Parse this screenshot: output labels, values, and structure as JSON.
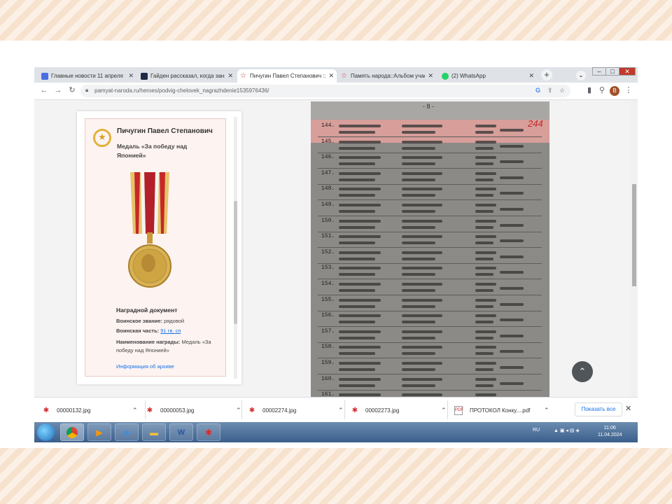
{
  "browser": {
    "tabs": [
      {
        "title": "Главные новости 11 апреля",
        "icon": "news-icon",
        "color": "#4a6fe3"
      },
      {
        "title": "Гайден рассказал, когда заня",
        "icon": "dzen-icon",
        "color": "#1f2a44"
      },
      {
        "title": "Пичугин Павел Степанович ::",
        "icon": "star-icon",
        "color": "#d32f2f"
      },
      {
        "title": "Память народа::Альбом учас",
        "icon": "star-icon",
        "color": "#d32f2f"
      },
      {
        "title": "(2) WhatsApp",
        "icon": "whatsapp-icon",
        "color": "#25d366"
      }
    ],
    "url": "pamyat-naroda.ru/heroes/podvig-chelovek_nagrazhdenie1535976436/",
    "avatar_letter": "В"
  },
  "card": {
    "name": "Пичугин Павел Степанович",
    "medal": "Медаль «За победу над Японией»",
    "section": "Наградной документ",
    "rank_label": "Воинское звание:",
    "rank_value": "рядовой",
    "unit_label": "Воинская часть:",
    "unit_value": "91 гв. сп",
    "award_label": "Наименование награды:",
    "award_value": "Медаль «За победу над Японией»",
    "archive_link": "Информация об архиве"
  },
  "document": {
    "page_number": "- 8 -",
    "annotation": "244",
    "row_numbers": [
      "144.",
      "145.",
      "146.",
      "147.",
      "148.",
      "149.",
      "150.",
      "151.",
      "152.",
      "153.",
      "154.",
      "155.",
      "156.",
      "157.",
      "158.",
      "159.",
      "160.",
      "161."
    ]
  },
  "downloads": {
    "items": [
      {
        "name": "00000132.jpg",
        "type": "image"
      },
      {
        "name": "00000053.jpg",
        "type": "image"
      },
      {
        "name": "00002274.jpg",
        "type": "image"
      },
      {
        "name": "00002273.jpg",
        "type": "image"
      },
      {
        "name": "ПРОТОКОЛ Конку....pdf",
        "type": "pdf"
      }
    ],
    "show_all": "Показать все"
  },
  "taskbar": {
    "lang": "RU",
    "time": "11:06",
    "date": "11.04.2024"
  }
}
